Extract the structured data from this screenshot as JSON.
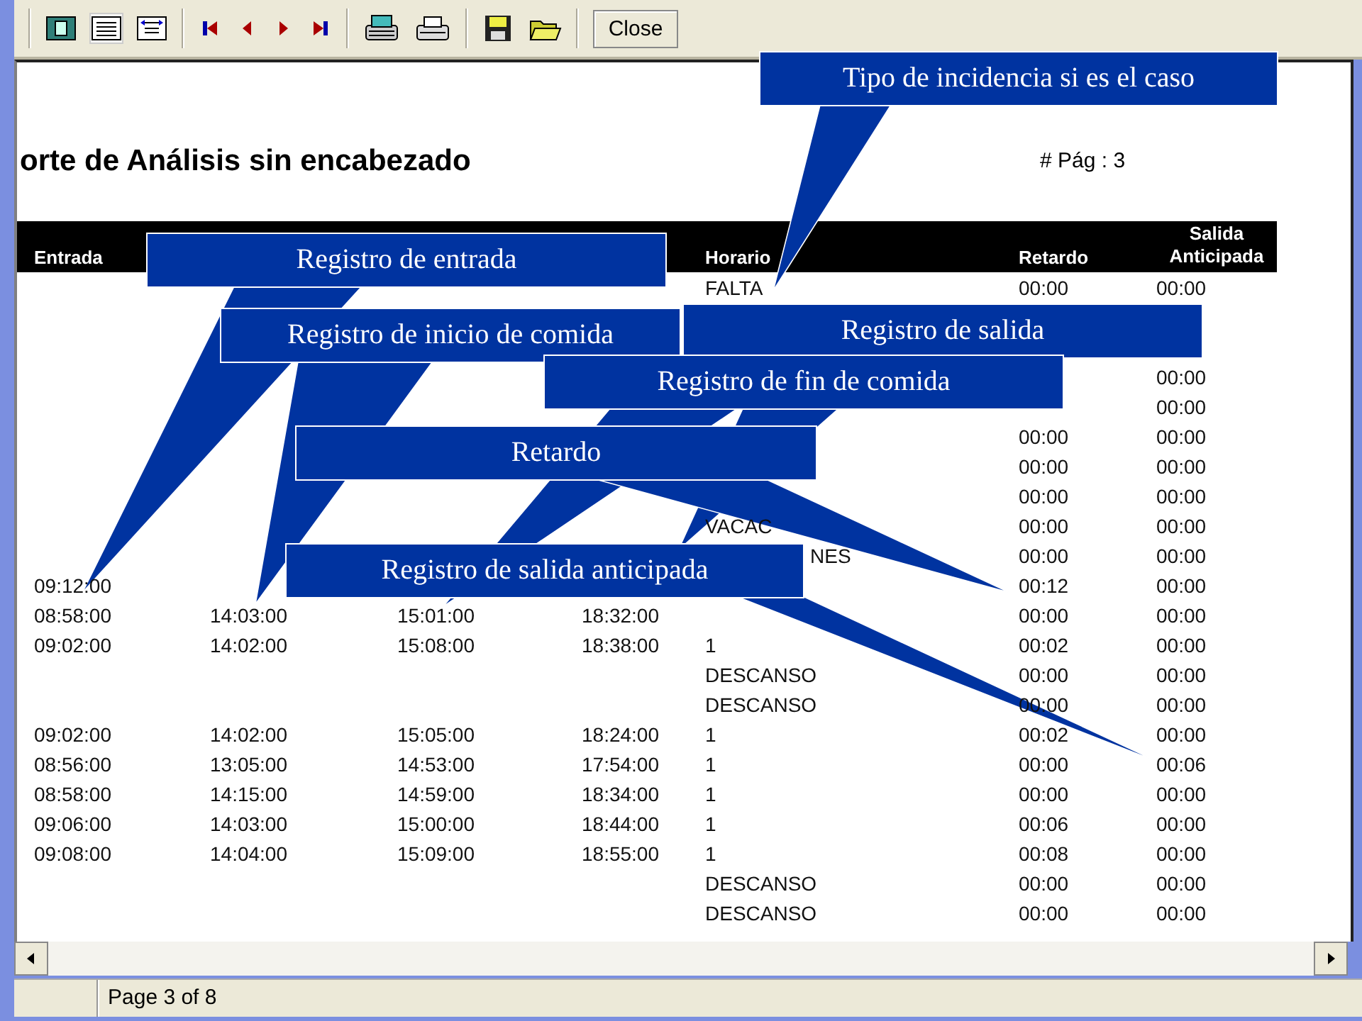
{
  "toolbar": {
    "close_button": "Close"
  },
  "report": {
    "title": "orte de Análisis sin encabezado",
    "page_label": "# Pág : 3",
    "columns": [
      "Entrada",
      null,
      null,
      null,
      "Horario",
      "Retardo",
      "Salida Anticipada"
    ],
    "rows": [
      [
        null,
        null,
        null,
        null,
        "FALTA",
        "00:00",
        "00:00"
      ],
      [
        null,
        null,
        null,
        null,
        null,
        null,
        null
      ],
      [
        null,
        null,
        null,
        null,
        null,
        null,
        null
      ],
      [
        null,
        null,
        null,
        null,
        null,
        null,
        "00:00"
      ],
      [
        null,
        null,
        null,
        null,
        null,
        null,
        "00:00"
      ],
      [
        null,
        null,
        null,
        null,
        null,
        "00:00",
        "00:00"
      ],
      [
        null,
        null,
        null,
        null,
        null,
        "00:00",
        "00:00"
      ],
      [
        null,
        null,
        null,
        null,
        null,
        "00:00",
        "00:00"
      ],
      [
        null,
        null,
        null,
        null,
        "VACAC",
        "00:00",
        "00:00"
      ],
      [
        null,
        null,
        null,
        null,
        "NES",
        "00:00",
        "00:00"
      ],
      [
        "09:12:00",
        null,
        null,
        null,
        null,
        "00:12",
        "00:00"
      ],
      [
        "08:58:00",
        "14:03:00",
        "15:01:00",
        "18:32:00",
        null,
        "00:00",
        "00:00"
      ],
      [
        "09:02:00",
        "14:02:00",
        "15:08:00",
        "18:38:00",
        "1",
        "00:02",
        "00:00"
      ],
      [
        null,
        null,
        null,
        null,
        "DESCANSO",
        "00:00",
        "00:00"
      ],
      [
        null,
        null,
        null,
        null,
        "DESCANSO",
        "00:00",
        "00:00"
      ],
      [
        "09:02:00",
        "14:02:00",
        "15:05:00",
        "18:24:00",
        "1",
        "00:02",
        "00:00"
      ],
      [
        "08:56:00",
        "13:05:00",
        "14:53:00",
        "17:54:00",
        "1",
        "00:00",
        "00:06"
      ],
      [
        "08:58:00",
        "14:15:00",
        "14:59:00",
        "18:34:00",
        "1",
        "00:00",
        "00:00"
      ],
      [
        "09:06:00",
        "14:03:00",
        "15:00:00",
        "18:44:00",
        "1",
        "00:06",
        "00:00"
      ],
      [
        "09:08:00",
        "14:04:00",
        "15:09:00",
        "18:55:00",
        "1",
        "00:08",
        "00:00"
      ],
      [
        null,
        null,
        null,
        null,
        "DESCANSO",
        "00:00",
        "00:00"
      ],
      [
        null,
        null,
        null,
        null,
        "DESCANSO",
        "00:00",
        "00:00"
      ]
    ]
  },
  "callouts": [
    "Tipo de incidencia si es el caso",
    "Registro de entrada",
    "Registro de inicio de comida",
    "Registro de salida",
    "Registro de fin de comida",
    "Retardo",
    "Registro de salida anticipada"
  ],
  "status_bar": {
    "page": "Page 3 of 8"
  }
}
